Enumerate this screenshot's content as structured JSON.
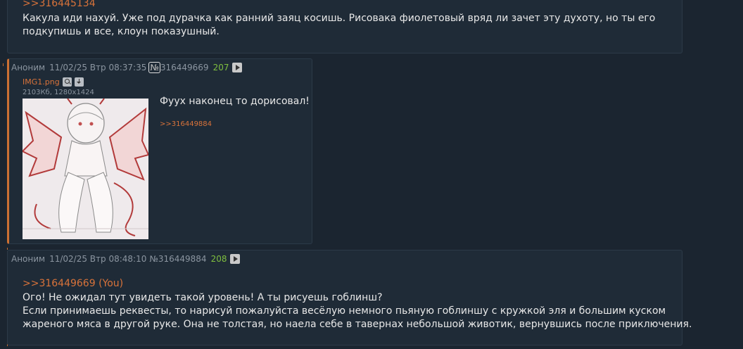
{
  "post_top": {
    "reply_link": ">>316445134",
    "lines": [
      "Какула иди нахуй. Уже под дурачка как ранний заяц косишь. Рисовака фиолетовый вряд ли зачет эту духоту, но ты его",
      "подкупишь и все, клоун показушный."
    ]
  },
  "post_op": {
    "name": "Аноним",
    "date": "11/02/25 Втр 08:37:35",
    "num_prefix": "№",
    "num": "316449669",
    "counter": "207",
    "file_name": "IMG1.png",
    "file_info": "2103Кб, 1280x1424",
    "text": "Фуух наконец то дорисовал!",
    "reply_ref": ">>316449884"
  },
  "post_bottom": {
    "name": "Аноним",
    "date": "11/02/25 Втр 08:48:10",
    "num": "№316449884",
    "counter": "208",
    "reply_link": ">>316449669 (You)",
    "lines": [
      "Ого! Не ожидал тут увидеть такой уровень! А ты рисуешь гоблинш?",
      "Если принимаешь реквесты, то нарисуй пожалуйста весёлую немного пьяную гоблиншу с кружкой эля и большим куском",
      "жареного мяса в другой руке. Она не толстая, но наела себе в тавернах небольшой животик, вернувшись после приключения."
    ]
  },
  "colors": {
    "background": "#1b2530",
    "post_bg": "#1f2b37",
    "link": "#d9733a",
    "counter": "#7fbf3f",
    "meta": "#8b95a0"
  }
}
